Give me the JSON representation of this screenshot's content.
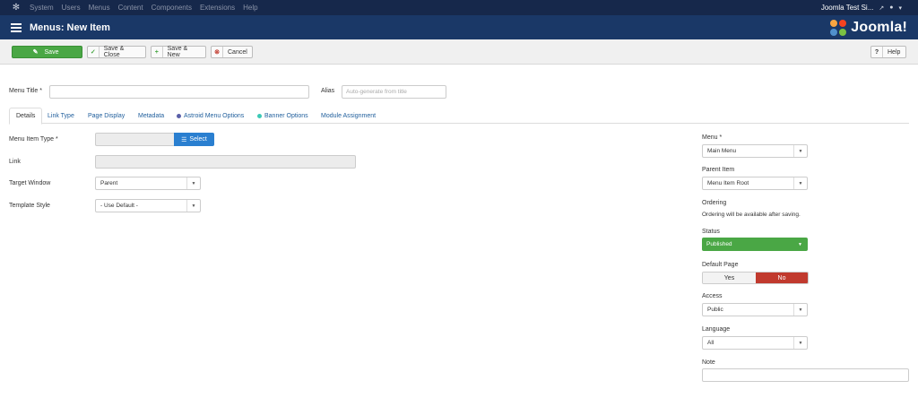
{
  "topbar": {
    "menu": [
      "System",
      "Users",
      "Menus",
      "Content",
      "Components",
      "Extensions",
      "Help"
    ],
    "site_name": "Joomla Test Si...",
    "external_icon": "external-link-icon",
    "user_icon": "user-icon"
  },
  "header": {
    "title": "Menus: New Item",
    "brand": "Joomla!"
  },
  "toolbar": {
    "save": "Save",
    "save_close": "Save & Close",
    "save_new": "Save & New",
    "cancel": "Cancel",
    "help": "Help"
  },
  "form": {
    "menu_title_label": "Menu Title *",
    "menu_title_value": "",
    "alias_label": "Alias",
    "alias_placeholder": "Auto-generate from title"
  },
  "tabs": [
    {
      "label": "Details"
    },
    {
      "label": "Link Type"
    },
    {
      "label": "Page Display"
    },
    {
      "label": "Metadata"
    },
    {
      "label": "Astroid Menu Options"
    },
    {
      "label": "Banner Options"
    },
    {
      "label": "Module Assignment"
    }
  ],
  "details": {
    "menu_item_type_label": "Menu Item Type *",
    "select_button": "Select",
    "link_label": "Link",
    "target_window_label": "Target Window",
    "target_window_value": "Parent",
    "template_style_label": "Template Style",
    "template_style_value": "- Use Default -"
  },
  "sidebar": {
    "menu_label": "Menu *",
    "menu_value": "Main Menu",
    "parent_label": "Parent Item",
    "parent_value": "Menu Item Root",
    "ordering_label": "Ordering",
    "ordering_text": "Ordering will be available after saving.",
    "status_label": "Status",
    "status_value": "Published",
    "default_page_label": "Default Page",
    "default_yes": "Yes",
    "default_no": "No",
    "access_label": "Access",
    "access_value": "Public",
    "language_label": "Language",
    "language_value": "All",
    "note_label": "Note",
    "note_value": ""
  },
  "colors": {
    "topbar": "#16284b",
    "header": "#1a3867",
    "save_green": "#4aa745",
    "select_blue": "#2a7fd0",
    "no_red": "#c13a2e",
    "link_blue": "#1f5e9c"
  }
}
